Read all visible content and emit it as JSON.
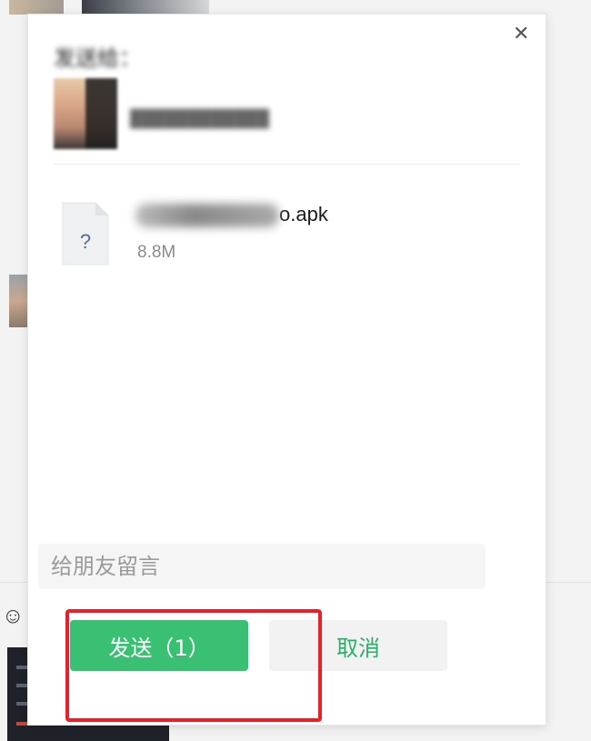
{
  "dialog": {
    "send_to_label": "发送给：",
    "recipient_name": "████████████",
    "file": {
      "name_suffix": "o.apk",
      "size": "8.8M",
      "icon": "unknown-file-icon",
      "icon_glyph": "?"
    },
    "message_placeholder": "给朋友留言",
    "send_label": "发送（1）",
    "cancel_label": "取消",
    "close_glyph": "✕"
  },
  "background": {
    "emoji_glyph": "☺"
  },
  "colors": {
    "send_bg": "#3ac073",
    "cancel_text": "#2aae67",
    "highlight": "#e8202a"
  }
}
